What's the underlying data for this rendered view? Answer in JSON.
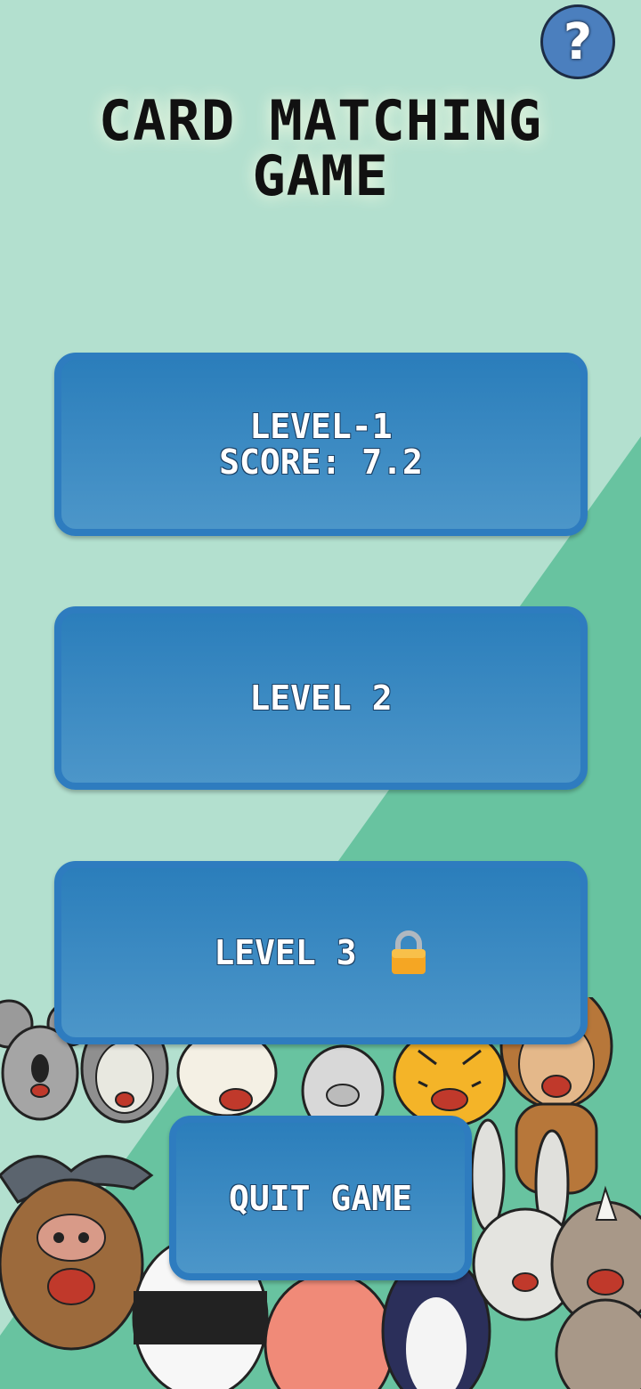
{
  "help": {
    "label": "?"
  },
  "title": {
    "line1": "CARD MATCHING",
    "line2": "GAME"
  },
  "levels": [
    {
      "line1": "LEVEL-1",
      "line2": "SCORE: 7.2"
    },
    {
      "line1": "LEVEL 2"
    },
    {
      "line1": "LEVEL 3",
      "icon": "lock-icon"
    }
  ],
  "quit": {
    "label": "QUIT GAME"
  },
  "colors": {
    "background": "#b3e0cf",
    "diagonal": "#68c3a0",
    "button": "#2e7cbf"
  }
}
